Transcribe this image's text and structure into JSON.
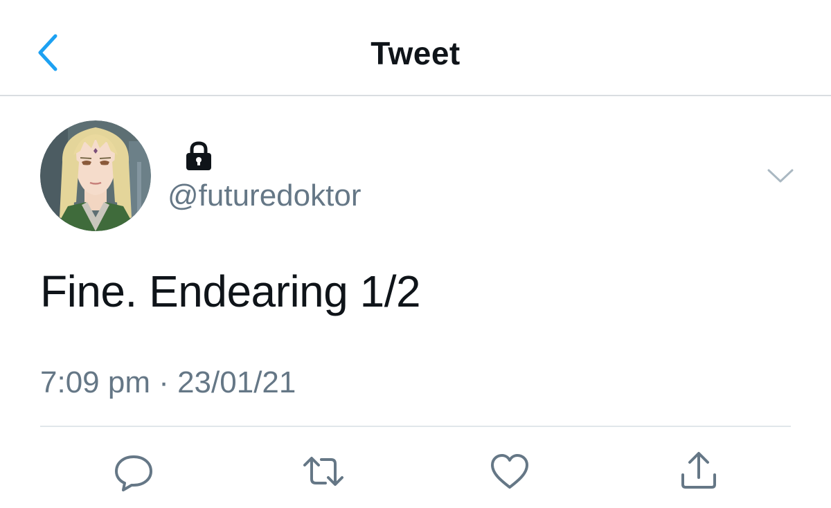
{
  "header": {
    "title": "Tweet",
    "back_icon": "chevron-left-icon"
  },
  "tweet": {
    "handle": "@futuredoktor",
    "protected_icon": "lock-icon",
    "text": "Fine. Endearing 1/2",
    "timestamp": "7:09 pm · 23/01/21",
    "menu_icon": "chevron-down-icon"
  },
  "actions": [
    "reply-icon",
    "retweet-icon",
    "like-icon",
    "share-icon"
  ],
  "colors": {
    "accent": "#1da1f2",
    "text_primary": "#0f1419",
    "text_secondary": "#657786",
    "divider": "#e1e6ea"
  }
}
